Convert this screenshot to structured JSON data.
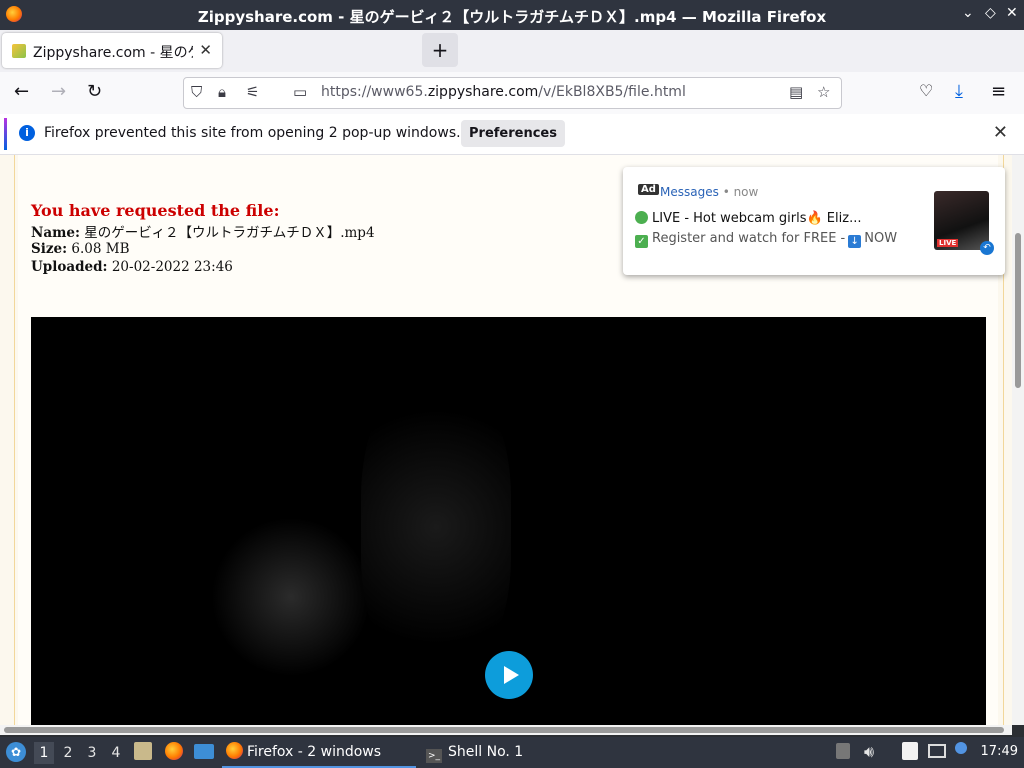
{
  "window": {
    "title": "Zippyshare.com - 星のゲービィ２【ウルトラガチムチＤＸ】.mp4 — Mozilla Firefox",
    "minimize": "⌄",
    "maximize": "◇",
    "close": "✕"
  },
  "tabs": [
    {
      "label": "Zippyshare.com - 星のゲ",
      "active": true
    }
  ],
  "newtab_label": "+",
  "nav": {
    "url_prefix": "https://www65.",
    "url_host": "zippyshare.com",
    "url_path": "/v/EkBl8XB5/file.html"
  },
  "notification": {
    "message": "Firefox prevented this site from opening 2 pop-up windows.",
    "button_label": "Preferences"
  },
  "page": {
    "heading": "You have requested the file:",
    "name_label": "Name:",
    "name_value": "星のゲービィ２【ウルトラガチムチＤＸ】.mp4",
    "size_label": "Size:",
    "size_value": "6.08 MB",
    "uploaded_label": "Uploaded:",
    "uploaded_value": "20-02-2022 23:46"
  },
  "ad": {
    "badge": "Ad",
    "source": "Messages",
    "time": "• now",
    "line1": "LIVE - Hot webcam girls🔥 Eliz...",
    "line2_prefix": "Register and watch for FREE -",
    "line2_suffix": "NOW",
    "thumb_badge": "LIVE"
  },
  "taskbar": {
    "workspaces": [
      "1",
      "2",
      "3",
      "4"
    ],
    "active_workspace": "1",
    "windows": [
      {
        "label": "Firefox - 2 windows",
        "active": true
      },
      {
        "label": "Shell No. 1",
        "active": false
      }
    ],
    "clock": "17:49"
  },
  "colors": {
    "heading_red": "#cc0000",
    "play_button": "#0d9ddb",
    "info_blue": "#0060df"
  }
}
